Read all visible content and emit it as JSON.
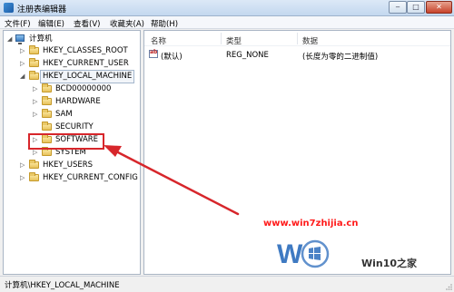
{
  "window": {
    "title": "注册表编辑器",
    "minimize_symbol": "‒",
    "maximize_symbol": "□",
    "close_symbol": "✕"
  },
  "menu": [
    "文件(F)",
    "编辑(E)",
    "查看(V)",
    "收藏夹(A)",
    "帮助(H)"
  ],
  "tree": {
    "root": "计算机",
    "hives": [
      {
        "label": "HKEY_CLASSES_ROOT",
        "expanded": false
      },
      {
        "label": "HKEY_CURRENT_USER",
        "expanded": false
      },
      {
        "label": "HKEY_LOCAL_MACHINE",
        "expanded": true,
        "selected": true
      },
      {
        "label": "HKEY_USERS",
        "expanded": false
      },
      {
        "label": "HKEY_CURRENT_CONFIG",
        "expanded": false
      }
    ],
    "local_machine_children": [
      "BCD00000000",
      "HARDWARE",
      "SAM",
      "SECURITY",
      "SOFTWARE",
      "SYSTEM"
    ],
    "highlighted_child": "SOFTWARE"
  },
  "list": {
    "columns": [
      "名称",
      "类型",
      "数据"
    ],
    "rows": [
      {
        "name": "(默认)",
        "type": "REG_NONE",
        "data": "(长度为零的二进制值)",
        "icon": "registry-value-icon"
      }
    ]
  },
  "statusbar": {
    "path": "计算机\\HKEY_LOCAL_MACHINE"
  },
  "watermarks": {
    "site1": "www.win7zhijia.cn",
    "site2": "Win10之家"
  },
  "colors": {
    "annotation": "#d7262b",
    "close_button": "#c7432b"
  }
}
